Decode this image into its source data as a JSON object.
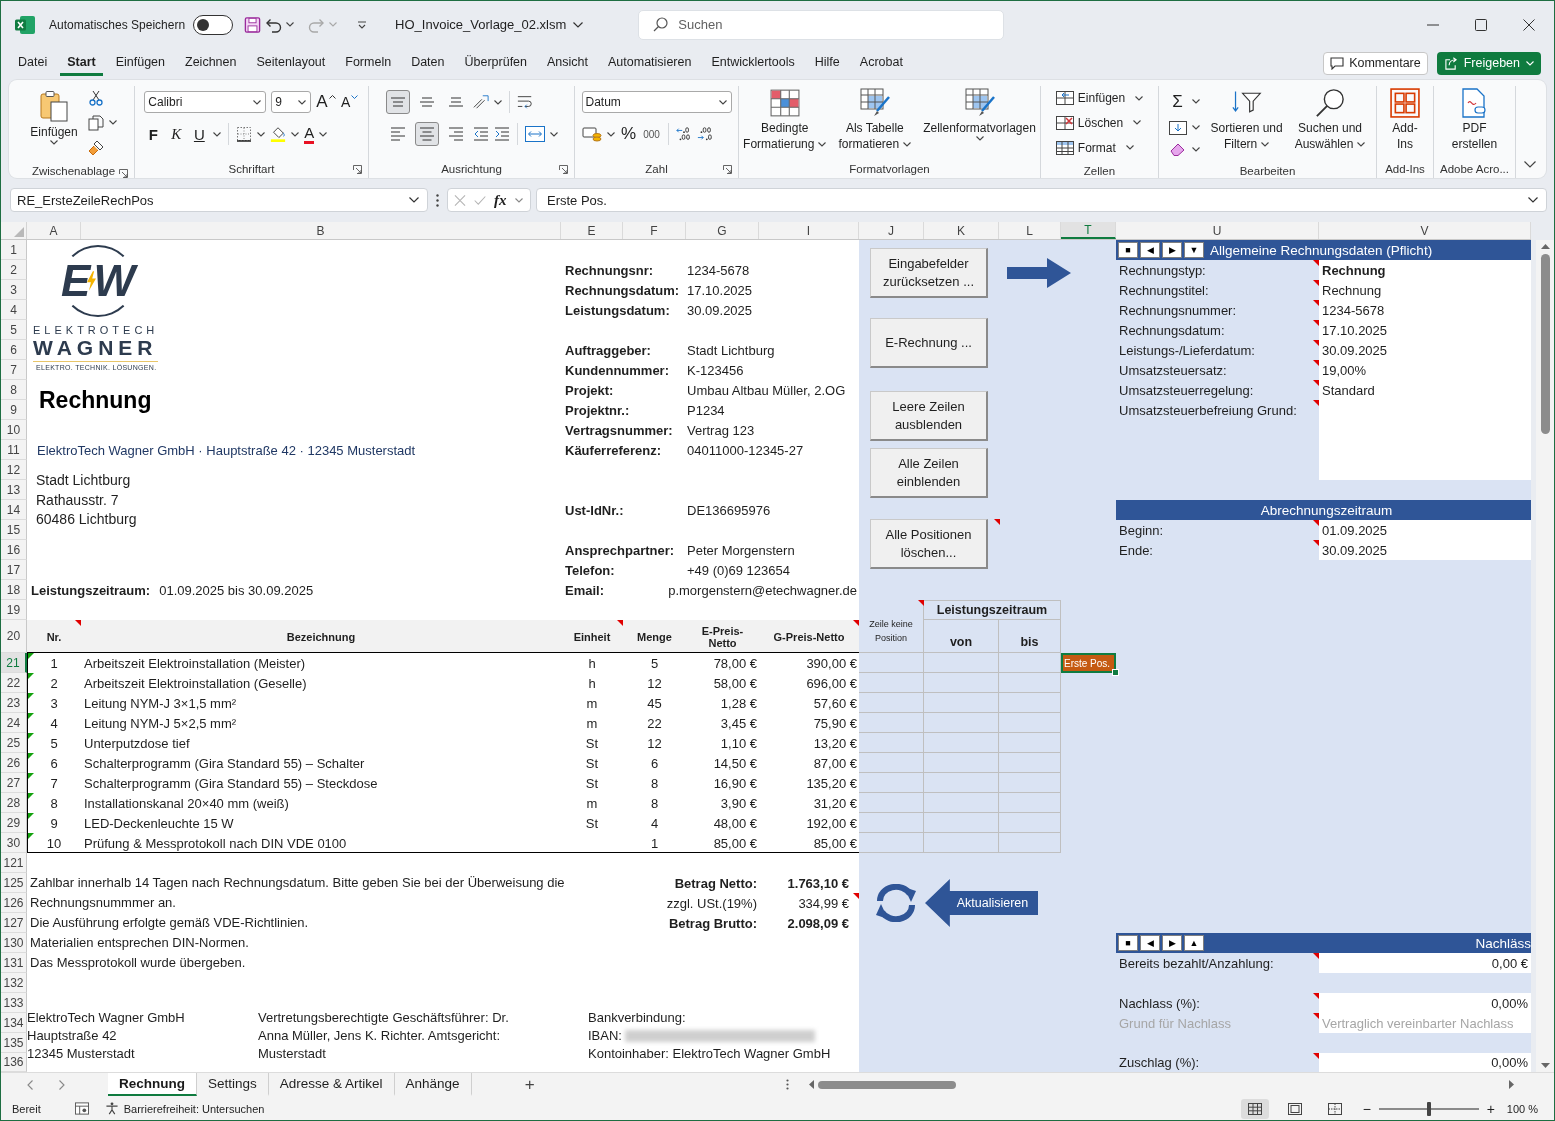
{
  "title_bar": {
    "autosave_label": "Automatisches Speichern",
    "autosave_on": false,
    "redo_disabled": true,
    "file_name": "HO_Invoice_Vorlage_02.xlsm",
    "search": {
      "placeholder": "Suchen"
    }
  },
  "menu_tabs": [
    {
      "label": "Datei",
      "selected": false
    },
    {
      "label": "Start",
      "selected": true
    },
    {
      "label": "Einfügen",
      "selected": false
    },
    {
      "label": "Zeichnen",
      "selected": false
    },
    {
      "label": "Seitenlayout",
      "selected": false
    },
    {
      "label": "Formeln",
      "selected": false
    },
    {
      "label": "Daten",
      "selected": false
    },
    {
      "label": "Überprüfen",
      "selected": false
    },
    {
      "label": "Ansicht",
      "selected": false
    },
    {
      "label": "Automatisieren",
      "selected": false
    },
    {
      "label": "Entwicklertools",
      "selected": false
    },
    {
      "label": "Hilfe",
      "selected": false
    },
    {
      "label": "Acrobat",
      "selected": false
    }
  ],
  "comments_button": "Kommentare",
  "share_button": "Freigeben",
  "ribbon": {
    "groups": [
      {
        "kind": "clipboard",
        "label": "Zwischenablage",
        "launcher": true,
        "paste": "Einfügen"
      },
      {
        "kind": "font",
        "label": "Schriftart",
        "launcher": true,
        "font": "Calibri",
        "size": "9",
        "grow": "A",
        "shrink": "A",
        "styles": [
          "F",
          "K",
          "U"
        ],
        "font_color": "A"
      },
      {
        "kind": "alignment",
        "label": "Ausrichtung",
        "launcher": true,
        "vertical": [
          {
            "selected": true
          },
          {
            "selected": false
          },
          {
            "selected": false
          }
        ],
        "horizontal": [
          {
            "selected": false
          },
          {
            "selected": true
          },
          {
            "selected": false
          }
        ]
      },
      {
        "kind": "number",
        "label": "Zahl",
        "launcher": true,
        "format": "Datum",
        "percent": "%",
        "thousands": "000"
      },
      {
        "kind": "styles",
        "label": "Formatvorlagen",
        "launcher": false,
        "buttons": [
          {
            "lines": [
              "Bedingte",
              "Formatierung"
            ]
          },
          {
            "lines": [
              "Als Tabelle",
              "formatieren"
            ]
          },
          {
            "lines": [
              "Zellenformatvorlagen"
            ]
          }
        ]
      },
      {
        "kind": "cells",
        "label": "Zellen",
        "launcher": false,
        "buttons": [
          "Einfügen",
          "Löschen",
          "Format"
        ]
      },
      {
        "kind": "editing",
        "label": "Bearbeiten",
        "launcher": false,
        "sum": "Σ",
        "buttons": [
          {
            "lines": [
              "Sortieren und",
              "Filtern"
            ]
          },
          {
            "lines": [
              "Suchen und",
              "Auswählen"
            ]
          }
        ]
      },
      {
        "kind": "addins",
        "label": "Add-Ins",
        "launcher": false,
        "buttons": [
          {
            "lines": [
              "Add-",
              "Ins"
            ]
          }
        ]
      },
      {
        "kind": "adobe",
        "label": "Adobe Acro...",
        "launcher": false,
        "buttons": [
          {
            "lines": [
              "PDF",
              "erstellen"
            ]
          }
        ]
      }
    ]
  },
  "formula_bar": {
    "name_box": "RE_ErsteZeileRechPos",
    "function_glyph": "fx",
    "entry_disabled": true,
    "formula": "Erste Pos."
  },
  "sheet": {
    "columns": [
      {
        "label": "A",
        "selected": false
      },
      {
        "label": "B",
        "selected": false
      },
      {
        "label": "E",
        "selected": false
      },
      {
        "label": "F",
        "selected": false
      },
      {
        "label": "G",
        "selected": false
      },
      {
        "label": "I",
        "selected": false
      },
      {
        "label": "J",
        "selected": false
      },
      {
        "label": "K",
        "selected": false
      },
      {
        "label": "L",
        "selected": false
      },
      {
        "label": "T",
        "selected": true
      },
      {
        "label": "U",
        "selected": false
      },
      {
        "label": "V",
        "selected": false
      }
    ],
    "rows": [
      {
        "label": "1",
        "selected": false
      },
      {
        "label": "2",
        "selected": false
      },
      {
        "label": "3",
        "selected": false
      },
      {
        "label": "4",
        "selected": false
      },
      {
        "label": "5",
        "selected": false
      },
      {
        "label": "6",
        "selected": false
      },
      {
        "label": "7",
        "selected": false
      },
      {
        "label": "8",
        "selected": false
      },
      {
        "label": "9",
        "selected": false
      },
      {
        "label": "10",
        "selected": false
      },
      {
        "label": "11",
        "selected": false
      },
      {
        "label": "12",
        "selected": false
      },
      {
        "label": "13",
        "selected": false
      },
      {
        "label": "14",
        "selected": false
      },
      {
        "label": "15",
        "selected": false
      },
      {
        "label": "16",
        "selected": false
      },
      {
        "label": "17",
        "selected": false
      },
      {
        "label": "18",
        "selected": false
      },
      {
        "label": "19",
        "selected": false
      },
      {
        "label": "20",
        "selected": false
      },
      {
        "label": "21",
        "selected": true
      },
      {
        "label": "22",
        "selected": false
      },
      {
        "label": "23",
        "selected": false
      },
      {
        "label": "24",
        "selected": false
      },
      {
        "label": "25",
        "selected": false
      },
      {
        "label": "26",
        "selected": false
      },
      {
        "label": "27",
        "selected": false
      },
      {
        "label": "28",
        "selected": false
      },
      {
        "label": "29",
        "selected": false
      },
      {
        "label": "30",
        "selected": false
      },
      {
        "label": "121",
        "selected": false
      },
      {
        "label": "125",
        "selected": false
      },
      {
        "label": "126",
        "selected": false
      },
      {
        "label": "127",
        "selected": false
      },
      {
        "label": "130",
        "selected": false
      },
      {
        "label": "131",
        "selected": false
      },
      {
        "label": "132",
        "selected": false
      },
      {
        "label": "133",
        "selected": false
      },
      {
        "label": "134",
        "selected": false
      },
      {
        "label": "135",
        "selected": false
      },
      {
        "label": "136",
        "selected": false
      }
    ],
    "logo": {
      "monogram": [
        "E",
        "W"
      ],
      "name_top": "ELEKTROTECH",
      "name_bottom": "WAGNER",
      "tagline": "ELEKTRO. TECHNIK. LÖSUNGEN."
    },
    "title": "Rechnung",
    "sender_line": "ElektroTech Wagner GmbH · Hauptstraße 42 · 12345 Musterstadt",
    "recipient": [
      "Stadt Lichtburg",
      "Rathausstr. 7",
      "60486 Lichtburg"
    ],
    "service_period": {
      "label": "Leistungszeitraum:",
      "value": "01.09.2025 bis 30.09.2025"
    },
    "details": [
      [
        {
          "label": "Rechnungsnr:",
          "value": "1234-5678"
        },
        {
          "label": "Rechnungsdatum:",
          "value": "17.10.2025"
        },
        {
          "label": "Leistungsdatum:",
          "value": "30.09.2025"
        }
      ],
      [
        {
          "label": "Auftraggeber:",
          "value": "Stadt Lichtburg"
        },
        {
          "label": "Kundennummer:",
          "value": "K-123456"
        },
        {
          "label": "Projekt:",
          "value": "Umbau Altbau Müller, 2.OG"
        },
        {
          "label": "Projektnr.:",
          "value": "P1234"
        },
        {
          "label": "Vertragsnummer:",
          "value": "Vertrag 123"
        },
        {
          "label": "Käuferreferenz:",
          "value": "04011000-12345-27"
        }
      ],
      [
        {
          "label": "Ust-IdNr.:",
          "value": "DE136695976"
        }
      ],
      [
        {
          "label": "Ansprechpartner:",
          "value": "Peter Morgenstern"
        },
        {
          "label": "Telefon:",
          "value": "+49 (0)69 123654"
        },
        {
          "label": "Email:",
          "value": "p.morgenstern@etechwagner.de"
        }
      ]
    ],
    "items": {
      "columns": [
        {
          "label": "Nr.",
          "note": true
        },
        {
          "label": "Bezeichnung",
          "note": false
        },
        {
          "label": "Einheit",
          "note": true
        },
        {
          "label": "Menge",
          "note": false
        },
        {
          "label": "E-Preis-Netto",
          "note": false
        },
        {
          "label": "G-Preis-Netto",
          "note": true
        }
      ],
      "rows": [
        {
          "nr": "1",
          "description": "Arbeitszeit Elektroinstallation (Meister)",
          "unit": "h",
          "quantity": "5",
          "unit_price": "78,00 €",
          "total": "390,00 €",
          "error_indicator": true
        },
        {
          "nr": "2",
          "description": "Arbeitszeit Elektroinstallation (Geselle)",
          "unit": "h",
          "quantity": "12",
          "unit_price": "58,00 €",
          "total": "696,00 €",
          "error_indicator": true
        },
        {
          "nr": "3",
          "description": "Leitung NYM-J 3×1,5 mm²",
          "unit": "m",
          "quantity": "45",
          "unit_price": "1,28 €",
          "total": "57,60 €",
          "error_indicator": true
        },
        {
          "nr": "4",
          "description": "Leitung NYM-J 5×2,5 mm²",
          "unit": "m",
          "quantity": "22",
          "unit_price": "3,45 €",
          "total": "75,90 €",
          "error_indicator": true
        },
        {
          "nr": "5",
          "description": "Unterputzdose tief",
          "unit": "St",
          "quantity": "12",
          "unit_price": "1,10 €",
          "total": "13,20 €",
          "error_indicator": true
        },
        {
          "nr": "6",
          "description": "Schalterprogramm (Gira Standard 55) – Schalter",
          "unit": "St",
          "quantity": "6",
          "unit_price": "14,50 €",
          "total": "87,00 €",
          "error_indicator": true
        },
        {
          "nr": "7",
          "description": "Schalterprogramm (Gira Standard 55) – Steckdose",
          "unit": "St",
          "quantity": "8",
          "unit_price": "16,90 €",
          "total": "135,20 €",
          "error_indicator": true
        },
        {
          "nr": "8",
          "description": "Installationskanal 20×40 mm (weiß)",
          "unit": "m",
          "quantity": "8",
          "unit_price": "3,90 €",
          "total": "31,20 €",
          "error_indicator": true
        },
        {
          "nr": "9",
          "description": "LED-Deckenleuchte 15 W",
          "unit": "St",
          "quantity": "4",
          "unit_price": "48,00 €",
          "total": "192,00 €",
          "error_indicator": true
        },
        {
          "nr": "10",
          "description": "Prüfung & Messprotokoll nach DIN VDE 0100",
          "quantity": "1",
          "unit_price": "85,00 €",
          "total": "85,00 €",
          "error_indicator": true
        }
      ]
    },
    "period_table": {
      "title": "Leistungszeitraum",
      "title_note": true,
      "columns": [
        "Zeile keine Position",
        "von",
        "bis"
      ]
    },
    "active_cell": {
      "text": "Erste Pos."
    },
    "notes": [
      "Zahlbar innerhalb 14 Tagen nach Rechnungsdatum. Bitte geben Sie bei der Überweisung die Rechnungsnummmer an.",
      "Die Ausführung erfolgte gemäß VDE-Richtlinien.",
      "Materialien entsprechen DIN-Normen.",
      "Das Messprotokoll wurde übergeben."
    ],
    "totals": [
      {
        "kind": "total",
        "label": "Betrag Netto:",
        "value": "1.763,10 €",
        "note": false
      },
      {
        "kind": "tax",
        "label": "zzgl. USt.(19%)",
        "value": "334,99 €",
        "note": true
      },
      {
        "kind": "total",
        "label": "Betrag Brutto:",
        "value": "2.098,09 €",
        "note": false
      }
    ],
    "footer": {
      "company": [
        "ElektroTech Wagner GmbH",
        "Hauptstraße 42",
        "12345 Musterstadt"
      ],
      "management": "Vertretungsberechtigte Geschäftsführer: Dr. Anna Müller, Jens K. Richter. Amtsgericht: Musterstadt",
      "bank": {
        "title": "Bankverbindung:",
        "iban_label": "IBAN:",
        "iban_redacted": true,
        "holder": "Kontoinhaber: ElektroTech Wagner GmbH"
      }
    },
    "macro_buttons": [
      {
        "label": "Eingabefelder zurücksetzen ...",
        "note": false
      },
      {
        "label": "E-Rechnung ...",
        "note": false
      },
      {
        "label": "Leere Zeilen ausblenden",
        "note": false
      },
      {
        "label": "Alle Zeilen einblenden",
        "note": false
      },
      {
        "label": "Alle Positionen löschen...",
        "note": true
      }
    ],
    "refresh_button": "Aktualisieren",
    "form_sections": [
      {
        "title": "Allgemeine Rechnungsdaten (Pflicht)",
        "nav_buttons": [
          "■",
          "◀",
          "▶",
          "▼"
        ],
        "groups": [
          [
            {
              "kind": "text",
              "label": "Rechnungstyp:",
              "value": "Rechnung",
              "note": true
            },
            {
              "kind": "text",
              "label": "Rechnungstitel:",
              "value": "Rechnung",
              "note": true
            },
            {
              "kind": "text",
              "label": "Rechnungsnummer:",
              "value": "1234-5678",
              "note": true
            },
            {
              "kind": "text",
              "label": "Rechnungsdatum:",
              "value": "17.10.2025",
              "note": true
            },
            {
              "kind": "text",
              "label": "Leistungs-/Lieferdatum:",
              "value": "30.09.2025",
              "note": true
            },
            {
              "kind": "text",
              "label": "Umsatzsteuersatz:",
              "value": "19,00%",
              "note": true
            },
            {
              "kind": "text",
              "label": "Umsatzsteuerregelung:",
              "value": "Standard",
              "note": true
            },
            {
              "kind": "multiline",
              "label": "Umsatzsteuerbefreiung Grund:",
              "note": true
            }
          ]
        ]
      },
      {
        "title": "Abrechnungszeitraum",
        "groups": [
          [
            {
              "kind": "text",
              "label": "Beginn:",
              "value": "01.09.2025",
              "note": true
            },
            {
              "kind": "text",
              "label": "Ende:",
              "value": "30.09.2025",
              "note": true
            }
          ]
        ]
      },
      {
        "title": "Nachläss",
        "nav_buttons": [
          "■",
          "◀",
          "▶",
          "▲"
        ],
        "groups": [
          [
            {
              "kind": "number",
              "label": "Bereits bezahlt/Anzahlung:",
              "value": "0,00 €",
              "note": true,
              "disabled": false
            }
          ],
          [
            {
              "kind": "number",
              "label": "Nachlass (%):",
              "value": "0,00%",
              "note": true,
              "disabled": false
            },
            {
              "kind": "text",
              "label": "Grund für Nachlass",
              "value": "Vertraglich vereinbarter Nachlass",
              "note": true,
              "disabled": true
            }
          ],
          [
            {
              "kind": "number",
              "label": "Zuschlag (%):",
              "value": "0,00%",
              "note": true,
              "disabled": false
            }
          ]
        ]
      }
    ]
  },
  "sheet_tabs": [
    {
      "label": "Rechnung",
      "selected": true
    },
    {
      "label": "Settings",
      "selected": false
    },
    {
      "label": "Adresse & Artikel",
      "selected": false
    },
    {
      "label": "Anhänge",
      "selected": false
    }
  ],
  "add_sheet": "+",
  "status_bar": {
    "mode": "Bereit",
    "accessibility": "Barrierefreiheit: Untersuchen",
    "views": [
      {
        "selected": true
      },
      {
        "selected": false
      },
      {
        "selected": false
      }
    ],
    "zoom_out": "−",
    "zoom_in": "+",
    "zoom": {
      "level": 0.5
    },
    "zoom_label": "100 %"
  }
}
